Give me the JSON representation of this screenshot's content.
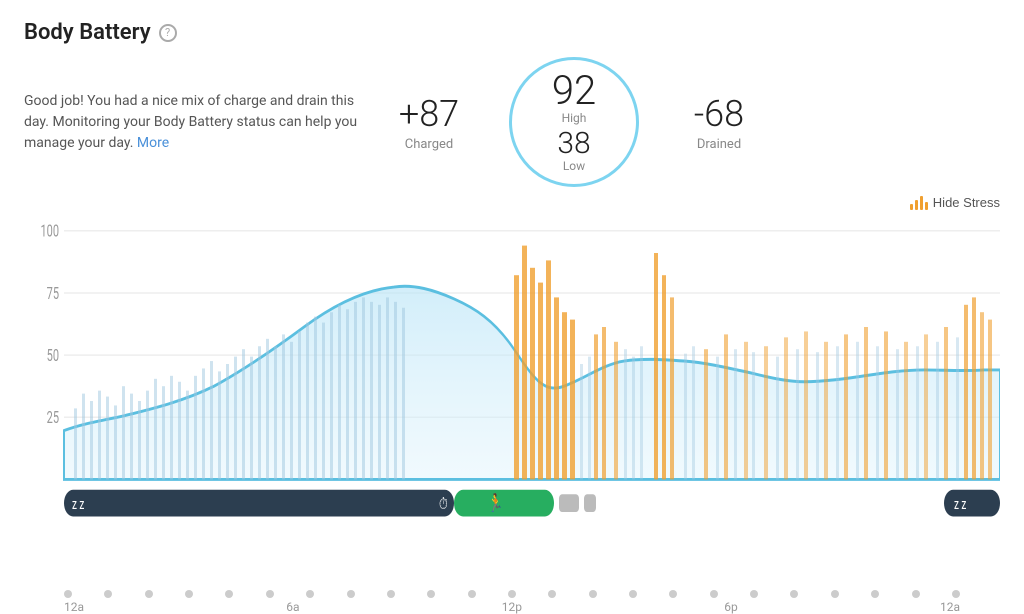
{
  "header": {
    "title": "Body Battery",
    "help_label": "?"
  },
  "description": {
    "text": "Good job! You had a nice mix of charge and drain this day. Monitoring your Body Battery status can help you manage your day.",
    "more_label": "More"
  },
  "stats": {
    "charged_value": "+87",
    "charged_label": "Charged",
    "high_value": "92",
    "high_label": "High",
    "low_value": "38",
    "low_label": "Low",
    "drained_value": "-68",
    "drained_label": "Drained"
  },
  "controls": {
    "hide_stress_label": "Hide Stress"
  },
  "chart": {
    "y_labels": [
      "100",
      "75",
      "50",
      "25"
    ],
    "x_labels": [
      "12a",
      "6a",
      "12p",
      "6p",
      "12a"
    ],
    "accent_color": "#7dd4f0",
    "stress_color": "#f0a030",
    "body_battery_color": "#a8d8f0"
  },
  "timeline": {
    "sleep_label": "sleep",
    "activity_label": "run"
  }
}
